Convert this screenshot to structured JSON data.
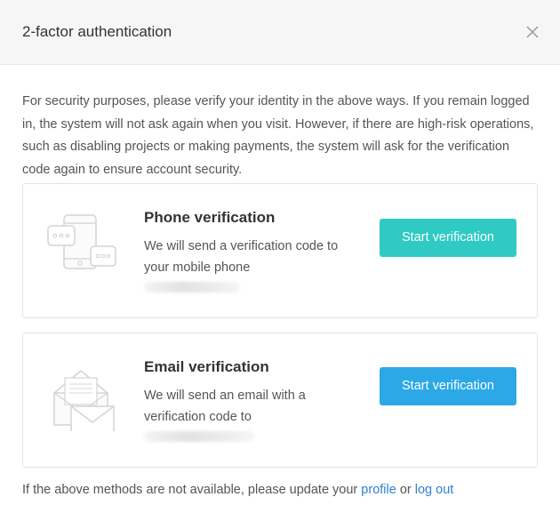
{
  "dialog": {
    "title": "2-factor authentication",
    "close_icon": "close-icon",
    "description": "For security purposes, please verify your identity in the above ways. If you remain logged in, the system will not ask again when you visit. However, if there are high-risk operations, such as disabling projects or making payments, the system will ask for the verification code again to ensure account security."
  },
  "phone": {
    "icon": "phone-chat-icon",
    "title": "Phone verification",
    "text": "We will send a verification code to your mobile phone",
    "button_label": "Start verification",
    "button_color": "#2ecac3"
  },
  "email": {
    "icon": "envelope-icon",
    "title": "Email verification",
    "text": "We will send an email with a verification code to",
    "button_label": "Start verification",
    "button_color": "#2ca8e6"
  },
  "footer": {
    "prefix": "If the above methods are not available, please update your",
    "profile_link": "profile",
    "or": "or",
    "logout_link": "log out",
    "link_color": "#2f80d1"
  }
}
